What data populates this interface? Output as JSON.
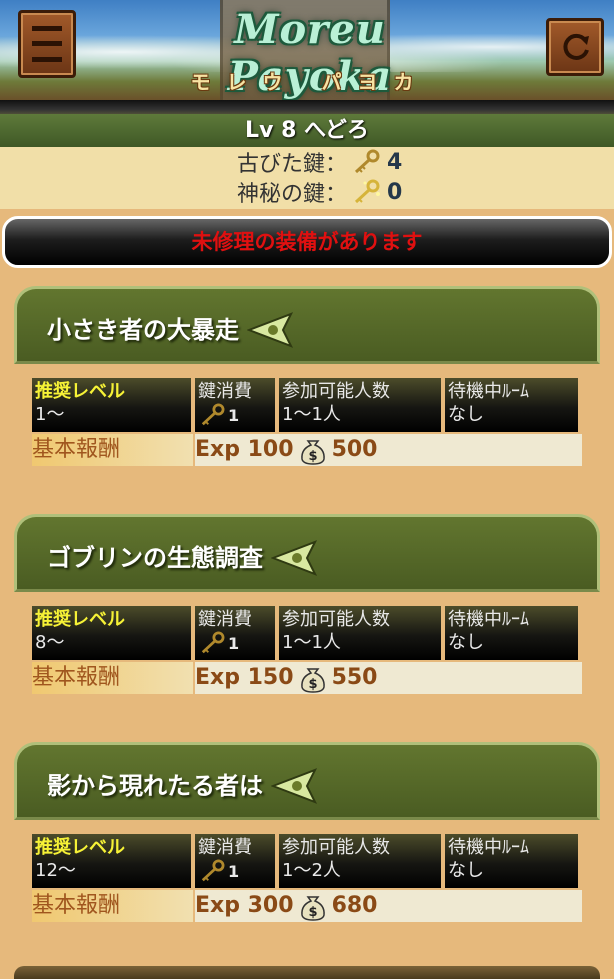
{
  "header": {
    "logo_text": "Moreu Payoka",
    "logo_kana": "モレウ パヨカ",
    "menu_icon": "hamburger-menu-icon",
    "reload_icon": "reload-icon"
  },
  "player": {
    "name_line": "Lv 8 へどろ",
    "keys": [
      {
        "label": "古びた鍵：",
        "count": "4",
        "icon": "old-key-icon"
      },
      {
        "label": "神秘の鍵：",
        "count": "0",
        "icon": "mystic-key-icon"
      }
    ]
  },
  "alert": {
    "text": "未修理の装備があります",
    "color": "#e01010"
  },
  "columns": {
    "level": "推奨レベル",
    "key_cost": "鍵消費",
    "players": "参加可能人数",
    "room": "待機中ﾙｰﾑ"
  },
  "reward_label": "基本報酬",
  "quests": [
    {
      "title": "小さき者の大暴走",
      "level": "1〜",
      "key_cost": "1",
      "players": "1〜1人",
      "room": "なし",
      "exp": "Exp 100",
      "gold": "500"
    },
    {
      "title": "ゴブリンの生態調査",
      "level": "8〜",
      "key_cost": "1",
      "players": "1〜1人",
      "room": "なし",
      "exp": "Exp 150",
      "gold": "550"
    },
    {
      "title": "影から現れたる者は",
      "level": "12〜",
      "key_cost": "1",
      "players": "1〜2人",
      "room": "なし",
      "exp": "Exp 300",
      "gold": "680"
    }
  ],
  "colors": {
    "background": "#e6b97c",
    "card_green": "#4a5c22",
    "level_yellow": "#f6f236",
    "reward_brown": "#8a4a16"
  }
}
